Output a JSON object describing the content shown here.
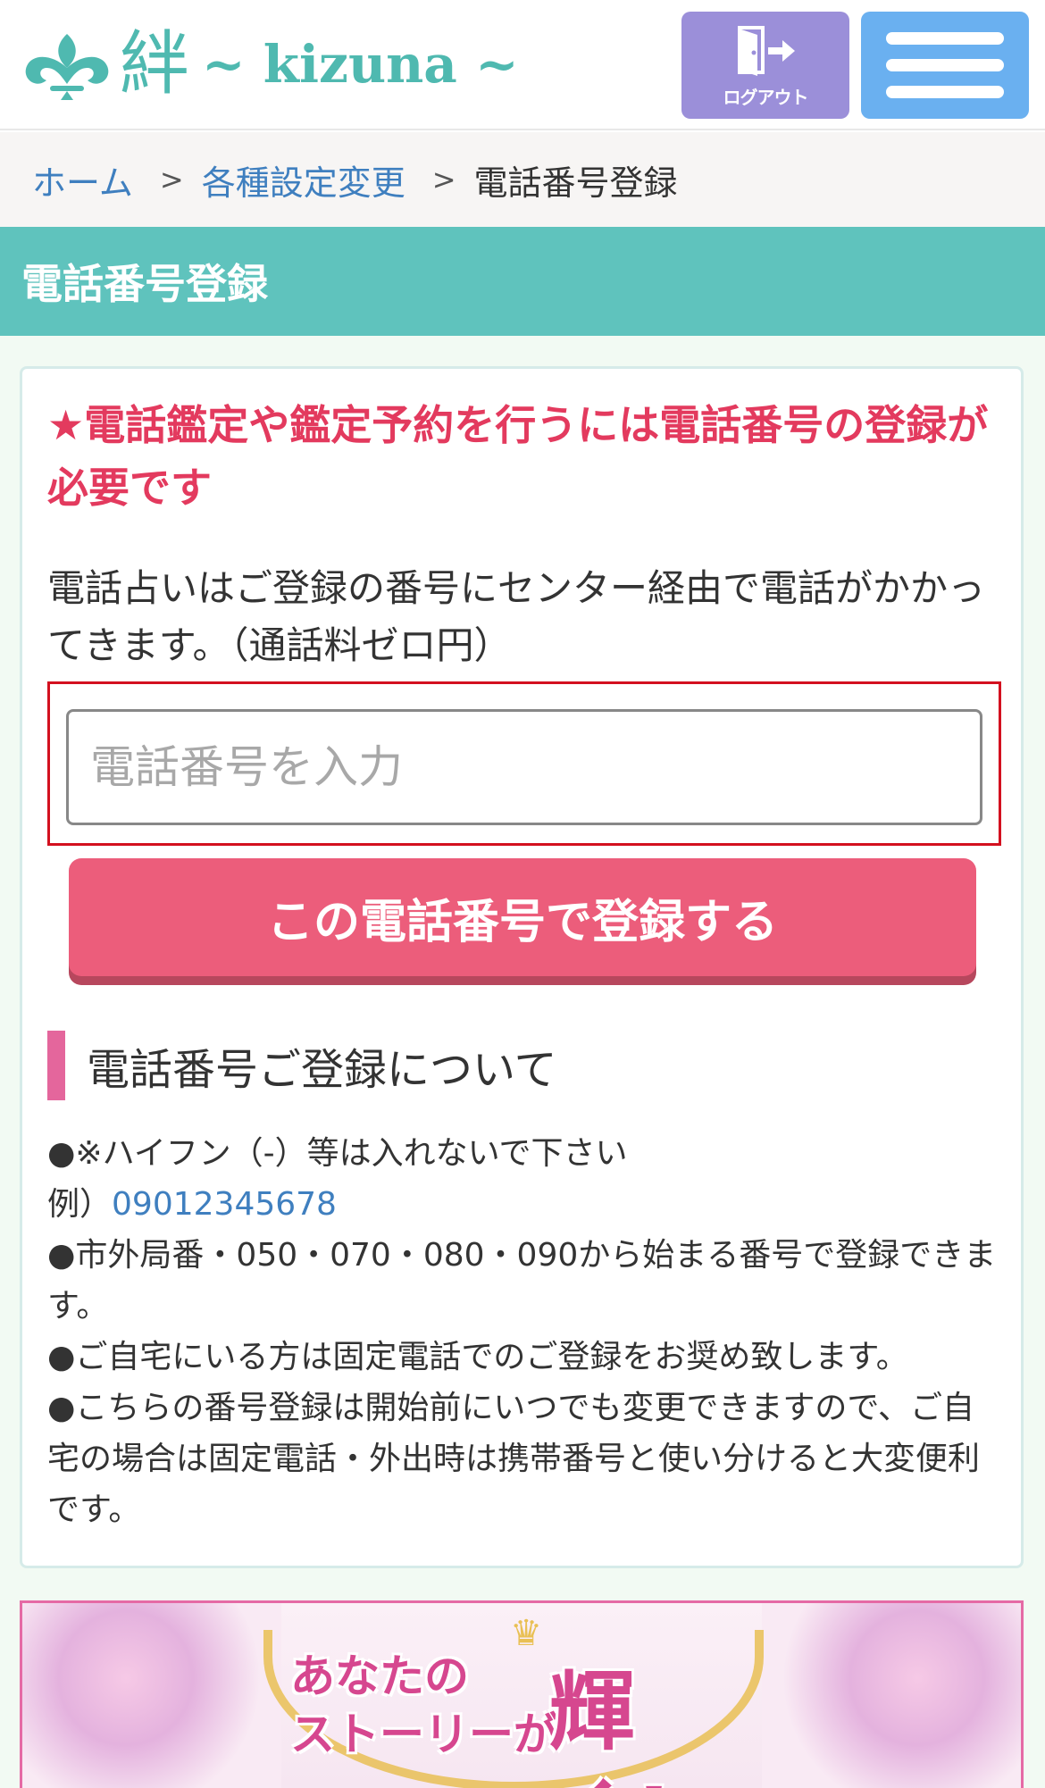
{
  "header": {
    "logo_kanji": "絆",
    "logo_roman": "~ kizuna ~",
    "logout_label": "ログアウト"
  },
  "breadcrumb": {
    "home": "ホーム",
    "settings": "各種設定変更",
    "current": "電話番号登録",
    "separator": ">"
  },
  "page": {
    "title": "電話番号登録"
  },
  "form": {
    "alert": "★電話鑑定や鑑定予約を行うには電話番号の登録が必要です",
    "description": "電話占いはご登録の番号にセンター経由で電話がかかってきます。（通話料ゼロ円）",
    "phone_value": "",
    "phone_placeholder": "電話番号を入力",
    "submit_label": "この電話番号で登録する"
  },
  "notes": {
    "heading": "電話番号ご登録について",
    "line1": "●※ハイフン（-）等は入れないで下さい",
    "example_prefix": "例）",
    "example_number": "09012345678",
    "line2": "●市外局番・050・070・080・090から始まる番号で登録できます。",
    "line3": "●ご自宅にいる方は固定電話でのご登録をお奨め致します。",
    "line4": "●こちらの番号登録は開始前にいつでも変更できますので、ご自宅の場合は固定電話・外出時は携帯番号と使い分けると大変便利です。"
  },
  "banner": {
    "line1": "あなたの",
    "line2": "ストーリーが",
    "big": "輝く!"
  },
  "colors": {
    "brand_teal": "#5fc3bd",
    "alert_red": "#e33a5e",
    "button_pink": "#ec5d7b",
    "logout_purple": "#9b8fd9",
    "menu_blue": "#6ab0f0",
    "link_blue": "#3f7fbf"
  },
  "icons": {
    "logo": "fleur-logo-icon",
    "logout": "door-exit-icon",
    "menu": "hamburger-menu-icon"
  }
}
